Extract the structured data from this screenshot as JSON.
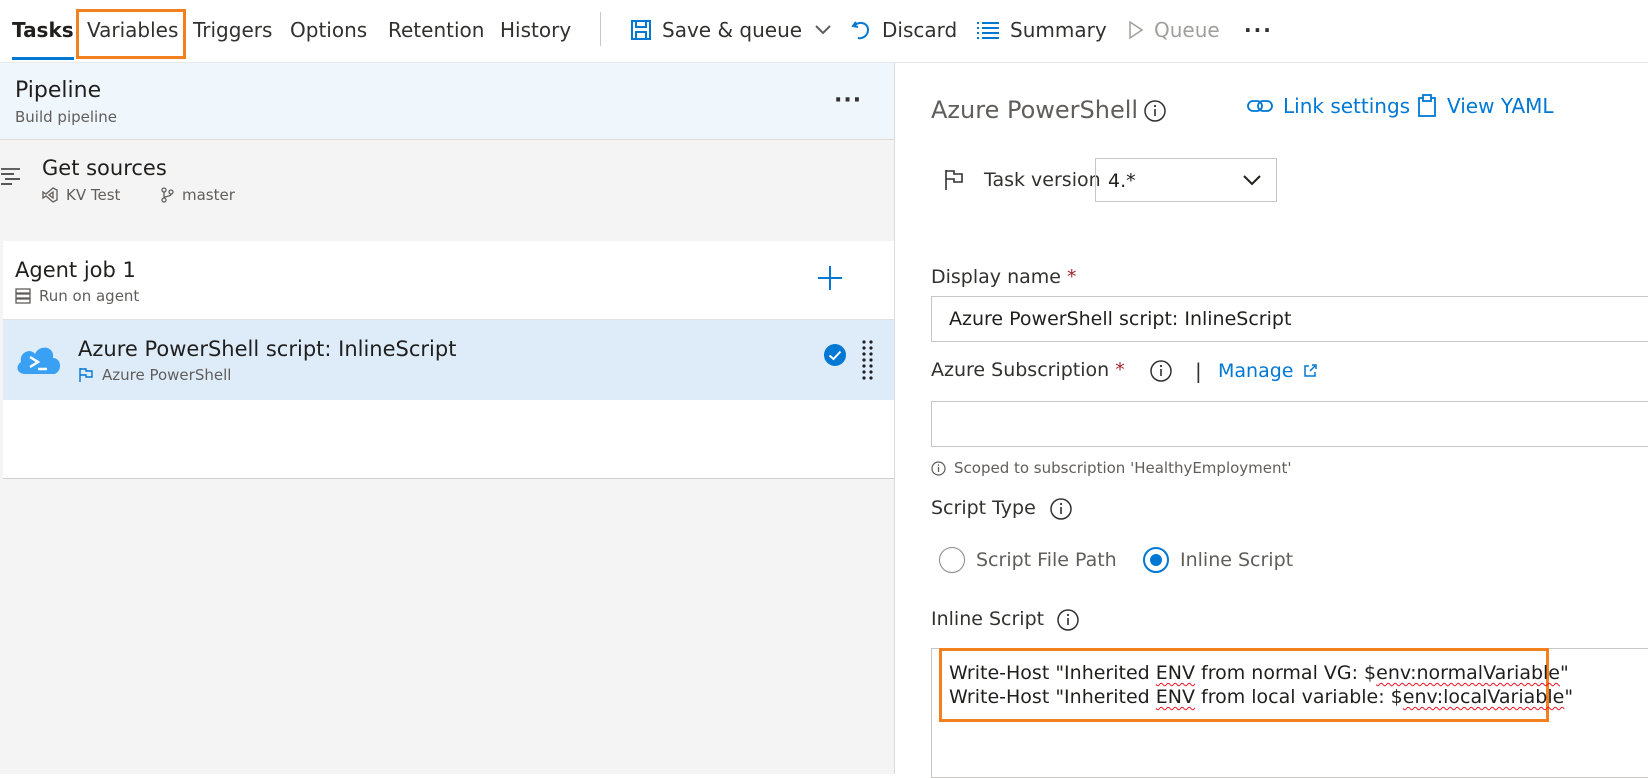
{
  "toolbar": {
    "tabs": [
      {
        "label": "Tasks"
      },
      {
        "label": "Variables"
      },
      {
        "label": "Triggers"
      },
      {
        "label": "Options"
      },
      {
        "label": "Retention"
      },
      {
        "label": "History"
      }
    ],
    "save_queue_label": "Save & queue",
    "discard_label": "Discard",
    "summary_label": "Summary",
    "queue_label": "Queue",
    "more_label": "···"
  },
  "pipeline": {
    "title": "Pipeline",
    "subtitle": "Build pipeline",
    "more_label": "···"
  },
  "get_sources": {
    "title": "Get sources",
    "repo": "KV Test",
    "branch": "master"
  },
  "agent_job": {
    "title": "Agent job 1",
    "subtitle": "Run on agent"
  },
  "task": {
    "title": "Azure PowerShell script: InlineScript",
    "subtitle": "Azure PowerShell"
  },
  "details": {
    "title": "Azure PowerShell",
    "link_settings_label": "Link settings",
    "view_yaml_label": "View YAML",
    "task_version_label": "Task version",
    "task_version_value": "4.*",
    "display_name_label": "Display name",
    "required_mark": "*",
    "display_name_value": "Azure PowerShell script: InlineScript",
    "azure_subscription_label": "Azure Subscription",
    "separator": "|",
    "manage_label": "Manage",
    "subscription_value": "",
    "scoped_note": "Scoped to subscription 'HealthyEmployment'",
    "script_type_label": "Script Type",
    "script_type_options": [
      "Script File Path",
      "Inline Script"
    ],
    "script_type_selected": "Inline Script",
    "inline_script_label": "Inline Script",
    "script_lines": [
      {
        "a": "Write-Host \"Inherited ",
        "b": "ENV",
        "c": " from normal VG: $",
        "d": "env:normalVariable",
        "e": "\""
      },
      {
        "a": "Write-Host \"Inherited ",
        "b": "ENV",
        "c": " from local variable: $",
        "d": "env:localVariable",
        "e": "\""
      }
    ]
  },
  "colors": {
    "accent": "#0078d4",
    "highlight": "#f2801f",
    "selected_row": "#deecf9",
    "header_bg": "#eff6fc",
    "required": "#a4262c"
  }
}
